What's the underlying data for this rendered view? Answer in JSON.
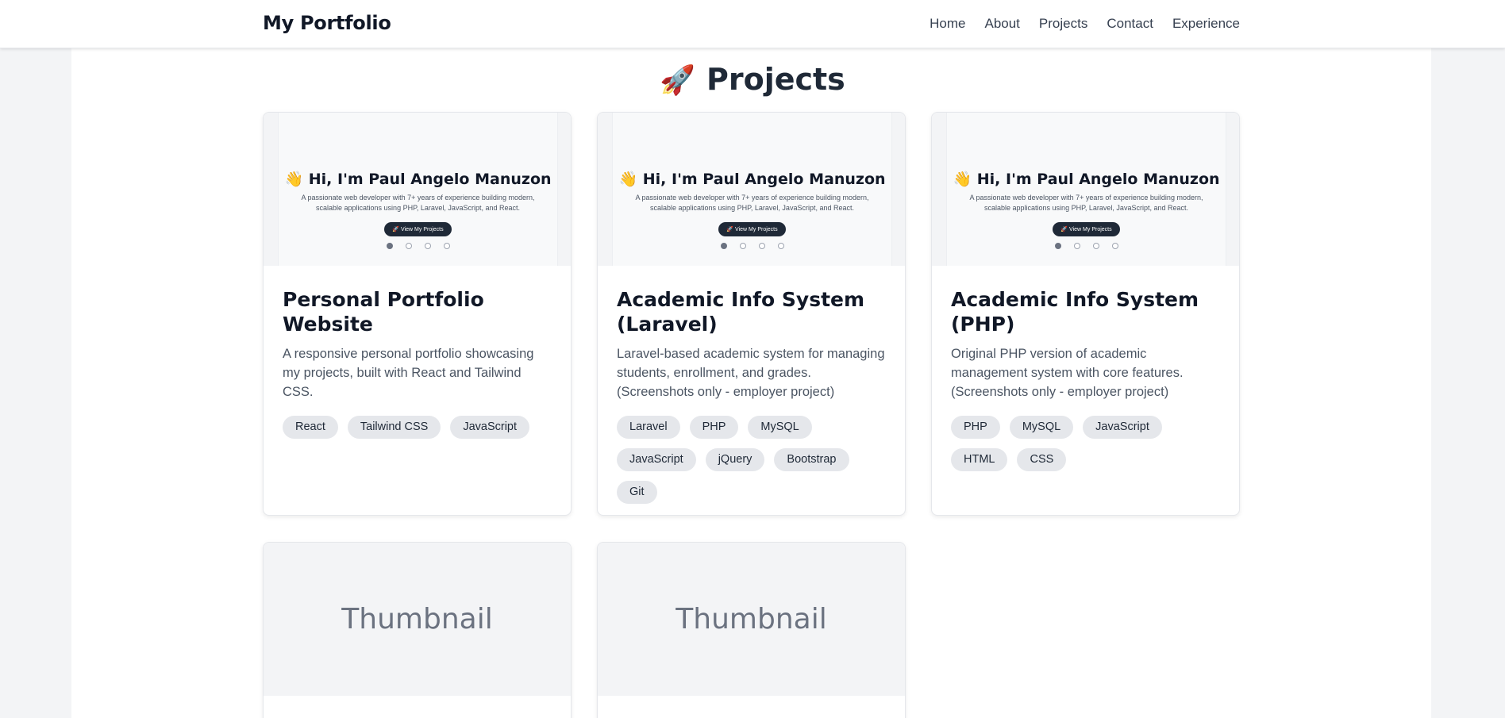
{
  "nav": {
    "brand": "My Portfolio",
    "links": [
      "Home",
      "About",
      "Projects",
      "Contact",
      "Experience"
    ]
  },
  "section": {
    "icon": "🚀",
    "title": "Projects"
  },
  "preview": {
    "wave": "👋",
    "heading": "Hi, I'm Paul Angelo Manuzon",
    "subtitle": "A passionate web developer with 7+ years of experience building modern, scalable applications using PHP, Laravel, JavaScript, and React.",
    "button": "🚀 View My Projects"
  },
  "projects": [
    {
      "title": "Personal Portfolio Website",
      "description": "A responsive personal portfolio showcasing my projects, built with React and Tailwind CSS.",
      "tags": [
        "React",
        "Tailwind CSS",
        "JavaScript"
      ]
    },
    {
      "title": "Academic Info System (Laravel)",
      "description": "Laravel-based academic system for managing students, enrollment, and grades. (Screenshots only - employer project)",
      "tags": [
        "Laravel",
        "PHP",
        "MySQL",
        "JavaScript",
        "jQuery",
        "Bootstrap",
        "Git"
      ]
    },
    {
      "title": "Academic Info System (PHP)",
      "description": "Original PHP version of academic management system with core features. (Screenshots only - employer project)",
      "tags": [
        "PHP",
        "MySQL",
        "JavaScript",
        "HTML",
        "CSS"
      ]
    }
  ],
  "placeholders": [
    {
      "label": "Thumbnail"
    },
    {
      "label": "Thumbnail"
    }
  ]
}
